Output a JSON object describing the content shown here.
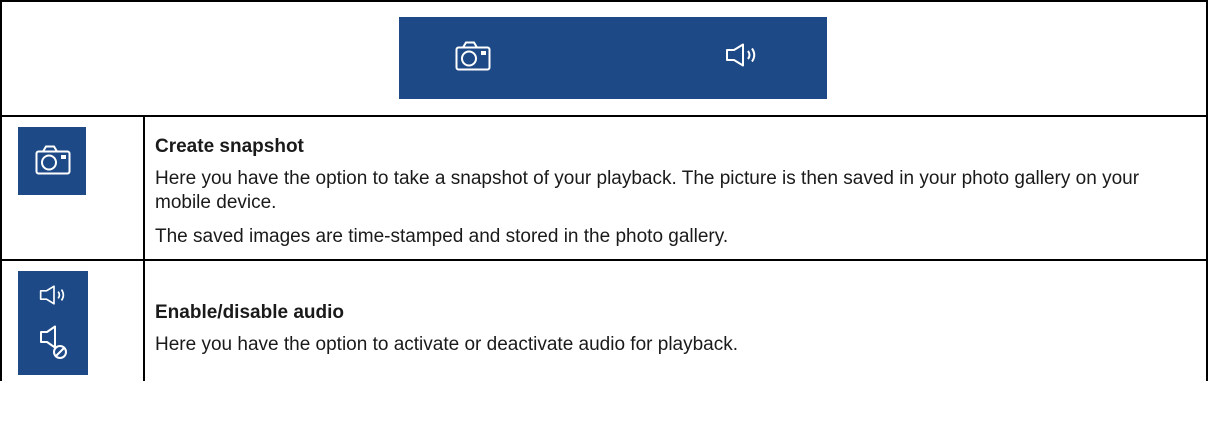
{
  "colors": {
    "icon_background": "#1d4a86",
    "icon_foreground": "#ffffff",
    "border": "#000000"
  },
  "preview_toolbar": {
    "icons": [
      "camera-icon",
      "speaker-icon"
    ]
  },
  "entries": [
    {
      "icons": [
        "camera-icon"
      ],
      "title": "Create snapshot",
      "paragraphs": [
        "Here you have the option to take a snapshot of your playback. The picture is then saved in your photo gallery on your mobile device.",
        "The saved images are time-stamped and stored in the photo gallery."
      ]
    },
    {
      "icons": [
        "speaker-icon",
        "speaker-muted-icon"
      ],
      "title": "Enable/disable audio",
      "paragraphs": [
        "Here you have the option to activate or deactivate audio for playback."
      ]
    }
  ]
}
